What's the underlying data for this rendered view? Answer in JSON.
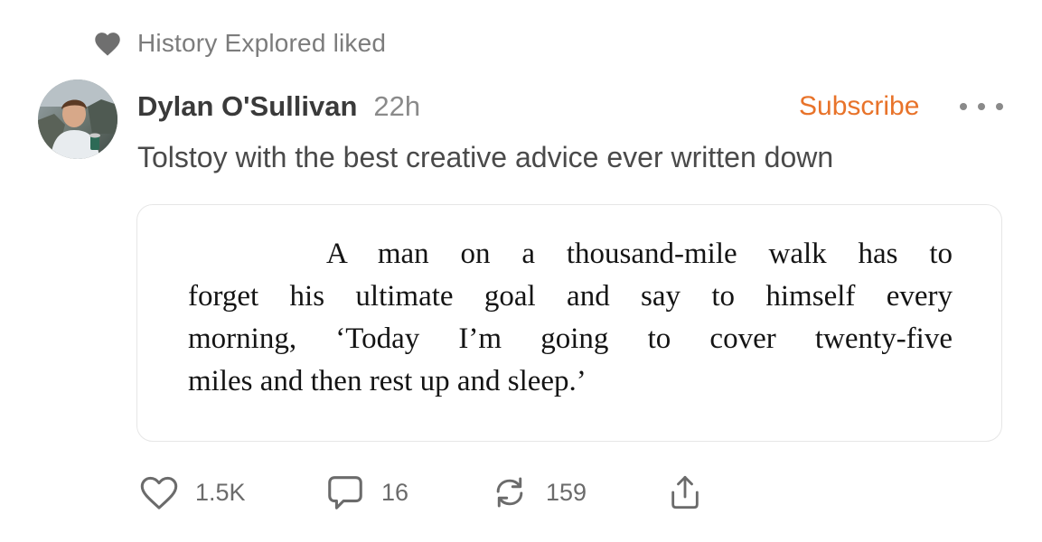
{
  "activity": {
    "liked_text": "History Explored liked",
    "liked_icon": "heart-filled-icon"
  },
  "post": {
    "author": "Dylan O'Sullivan",
    "time": "22h",
    "subscribe_label": "Subscribe",
    "more_icon": "more-dots-icon",
    "body": "Tolstoy with the best creative advice ever written down",
    "quote_lines": [
      "A man on a thousand-mile walk has to",
      "forget his ultimate goal and say to himself every",
      "morning, ‘Today I’m going to cover twenty-five",
      "miles and then rest up and sleep.’"
    ]
  },
  "actions": {
    "likes": "1.5K",
    "comments": "16",
    "restacks": "159",
    "like_icon": "heart-outline-icon",
    "comment_icon": "speech-bubble-icon",
    "restack_icon": "restack-arrows-icon",
    "share_icon": "share-upload-icon"
  },
  "colors": {
    "accent": "#e8732a",
    "muted": "#8a8a8a",
    "text": "#3a3a3a"
  }
}
